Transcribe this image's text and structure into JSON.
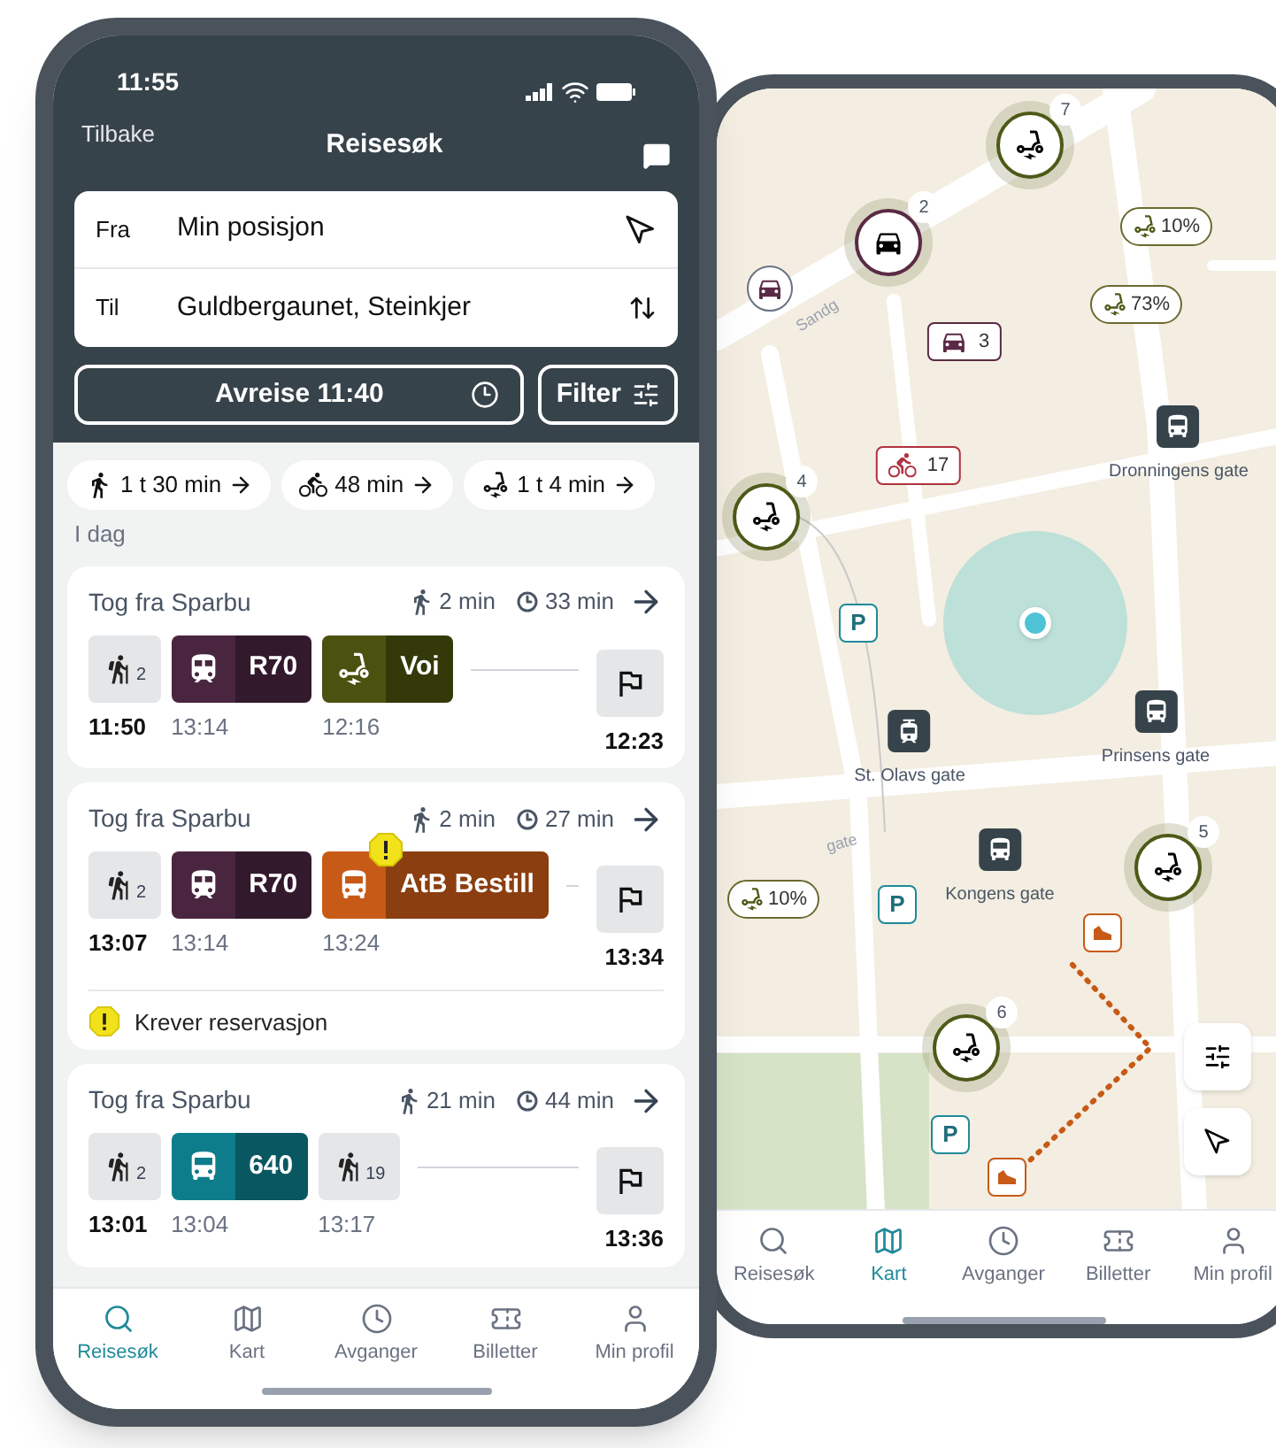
{
  "search_phone": {
    "status_time": "11:55",
    "back": "Tilbake",
    "title": "Reisesøk",
    "from": {
      "label": "Fra",
      "value": "Min posisjon"
    },
    "to": {
      "label": "Til",
      "value": "Guldbergaunet, Steinkjer"
    },
    "departure": "Avreise 11:40",
    "filter": "Filter",
    "mode_chips": [
      {
        "kind": "walk",
        "label": "1 t 30 min"
      },
      {
        "kind": "bike",
        "label": "48 min"
      },
      {
        "kind": "scooter",
        "label": "1 t 4 min"
      }
    ],
    "day_label": "I dag",
    "trips": [
      {
        "title": "Tog fra Sparbu",
        "walk": "2 min",
        "duration": "33 min",
        "arrival": "12:23",
        "legs": [
          {
            "kind": "walk",
            "sub": "2",
            "time": "11:50"
          },
          {
            "kind": "train",
            "line": "R70",
            "color": "#4a2540",
            "time": "13:14",
            "warning": false
          },
          {
            "kind": "scooter",
            "line": "Voi",
            "color": "#4b520f",
            "time": "12:16",
            "warning": false
          }
        ]
      },
      {
        "title": "Tog fra Sparbu",
        "walk": "2 min",
        "duration": "27 min",
        "arrival": "13:34",
        "notice": "Krever reservasjon",
        "legs": [
          {
            "kind": "walk",
            "sub": "2",
            "time": "13:07"
          },
          {
            "kind": "train",
            "line": "R70",
            "color": "#4a2540",
            "time": "13:14",
            "warning": false
          },
          {
            "kind": "bus",
            "line": "AtB Bestill",
            "color": "#c75a16",
            "time": "13:24",
            "warning": true
          }
        ]
      },
      {
        "title": "Tog fra Sparbu",
        "walk": "21 min",
        "duration": "44 min",
        "arrival": "13:36",
        "legs": [
          {
            "kind": "walk",
            "sub": "2",
            "time": "13:01"
          },
          {
            "kind": "bus",
            "line": "640",
            "color": "#0d7d8b",
            "time": "13:04",
            "warning": false
          },
          {
            "kind": "walk",
            "sub": "19",
            "time": "13:17"
          }
        ]
      }
    ],
    "tabs": [
      {
        "kind": "search",
        "label": "Reisesøk",
        "selected": true
      },
      {
        "kind": "map",
        "label": "Kart",
        "selected": false
      },
      {
        "kind": "clock",
        "label": "Avganger",
        "selected": false
      },
      {
        "kind": "ticket",
        "label": "Billetter",
        "selected": false
      },
      {
        "kind": "user",
        "label": "Min profil",
        "selected": false
      }
    ]
  },
  "map_phone": {
    "street_labels": [
      "Sandg",
      "gate"
    ],
    "markers": [
      {
        "kind": "scooter_cluster",
        "count": "7"
      },
      {
        "kind": "scooter_bubble",
        "label": "10%"
      },
      {
        "kind": "car_cluster",
        "count": "2"
      },
      {
        "kind": "car_pin"
      },
      {
        "kind": "scooter_bubble",
        "label": "73%"
      },
      {
        "kind": "car_tag",
        "count": "3",
        "color": "#5a2a45"
      },
      {
        "kind": "bus_stop",
        "label": "Dronningens gate"
      },
      {
        "kind": "bike_tag",
        "count": "17",
        "color": "#b0323f"
      },
      {
        "kind": "scooter_cluster",
        "count": "4"
      },
      {
        "kind": "parking",
        "label": "P"
      },
      {
        "kind": "tram_stop",
        "label": "St. Olavs gate"
      },
      {
        "kind": "bus_stop",
        "label": "Prinsens gate"
      },
      {
        "kind": "scooter_bubble",
        "label": "10%"
      },
      {
        "kind": "parking",
        "label": "P"
      },
      {
        "kind": "bus_stop",
        "label": "Kongens gate"
      },
      {
        "kind": "scooter_cluster",
        "count": "5"
      },
      {
        "kind": "walk"
      },
      {
        "kind": "scooter_cluster",
        "count": "6"
      },
      {
        "kind": "parking",
        "label": "P"
      },
      {
        "kind": "walk"
      }
    ],
    "tabs": [
      {
        "kind": "search",
        "label": "Reisesøk",
        "selected": false
      },
      {
        "kind": "map",
        "label": "Kart",
        "selected": true
      },
      {
        "kind": "clock",
        "label": "Avganger",
        "selected": false
      },
      {
        "kind": "ticket",
        "label": "Billetter",
        "selected": false
      },
      {
        "kind": "user",
        "label": "Min profil",
        "selected": false
      }
    ]
  }
}
